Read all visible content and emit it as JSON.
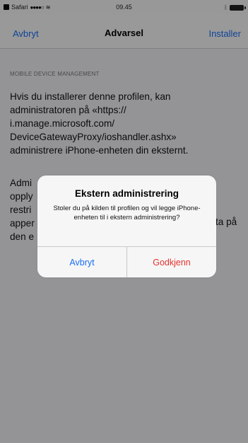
{
  "status_bar": {
    "carrier": "Safari",
    "signal": "●●●●○",
    "time": "09.45"
  },
  "nav": {
    "left": "Avbryt",
    "title": "Advarsel",
    "right": "Installer"
  },
  "section": {
    "header": "MOBILE DEVICE MANAGEMENT"
  },
  "body_lines_1": [
    "Hvis du installerer denne profilen, kan",
    "administratoren på «https://",
    "i.manage.microsoft.com/",
    "DeviceGatewayProxy/ioshandler.ashx»",
    "administrere iPhone-enheten din eksternt."
  ],
  "body_lines_2": [
    "Admi",
    "opply",
    "restri",
    "apper",
    "den e"
  ],
  "body_right_fragment": "ta på",
  "alert": {
    "title": "Ekstern administrering",
    "message": "Stoler du på kilden til profilen og vil legge iPhone-enheten til i ekstern administrering?",
    "cancel": "Avbryt",
    "approve": "Godkjenn"
  },
  "colors": {
    "ios_blue": "#1a6ef5",
    "destructive_red": "#e5322e"
  }
}
